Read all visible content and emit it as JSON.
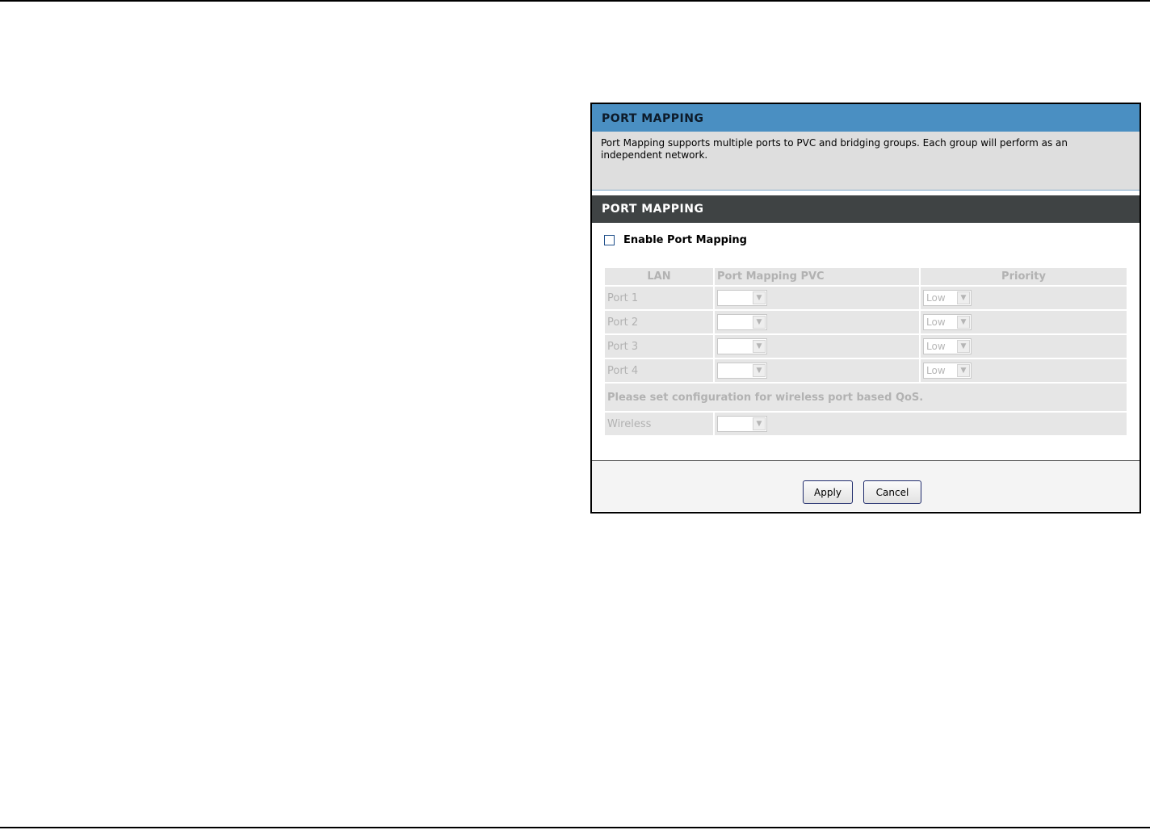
{
  "info": {
    "title": "PORT MAPPING",
    "description": "Port Mapping supports multiple ports to PVC and bridging groups. Each group will perform as an independent network."
  },
  "section": {
    "title": "PORT MAPPING",
    "enable_label": "Enable Port Mapping",
    "enable_checked": false
  },
  "table": {
    "headers": {
      "lan": "LAN",
      "pvc": "Port Mapping PVC",
      "priority": "Priority"
    },
    "rows": [
      {
        "lan": "Port 1",
        "pvc": "",
        "priority": "Low"
      },
      {
        "lan": "Port 2",
        "pvc": "",
        "priority": "Low"
      },
      {
        "lan": "Port 3",
        "pvc": "",
        "priority": "Low"
      },
      {
        "lan": "Port 4",
        "pvc": "",
        "priority": "Low"
      }
    ],
    "qos_note": "Please set configuration for wireless port based QoS.",
    "wireless": {
      "label": "Wireless",
      "value": ""
    }
  },
  "buttons": {
    "apply": "Apply",
    "cancel": "Cancel"
  },
  "colors": {
    "info_header": "#4a8fc2",
    "section_header": "#3f4344",
    "disabled_text": "#b2b2b2"
  }
}
